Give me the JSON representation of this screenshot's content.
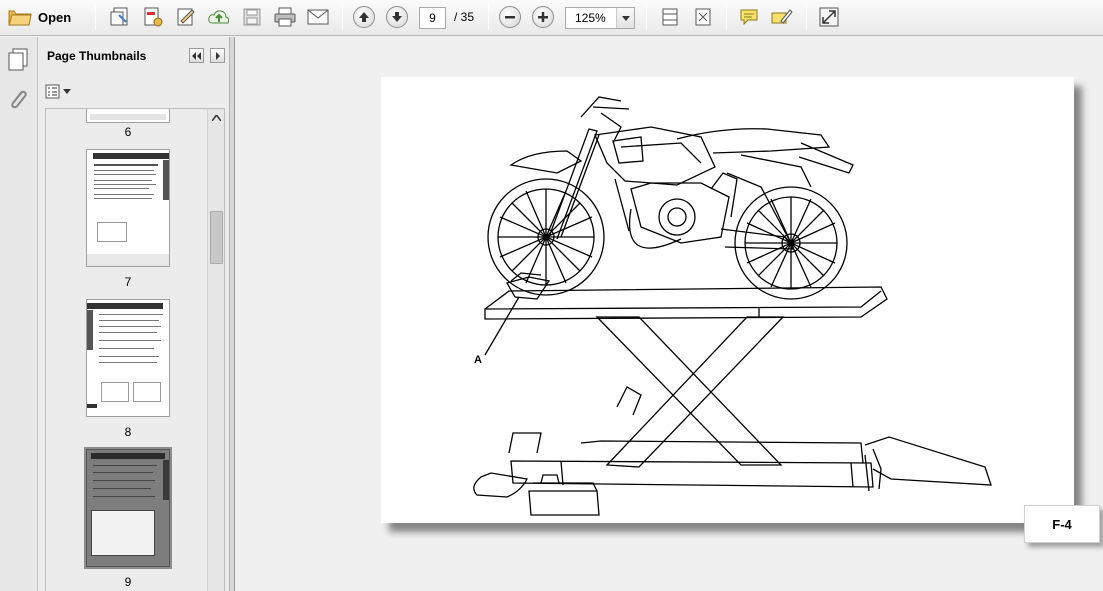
{
  "toolbar": {
    "open_label": "Open",
    "page_current": "9",
    "page_total": "/ 35",
    "zoom": "125%"
  },
  "thumbnails": {
    "title": "Page Thumbnails",
    "pages": [
      {
        "label": "6"
      },
      {
        "label": "7"
      },
      {
        "label": "8"
      },
      {
        "label": "9",
        "selected": true
      }
    ]
  },
  "document": {
    "callout": "A",
    "figure_label": "F-4"
  },
  "colors": {
    "selection": "#8c8c8c",
    "accent_blue": "#3b78c4",
    "folder_yellow": "#e8b84a"
  }
}
